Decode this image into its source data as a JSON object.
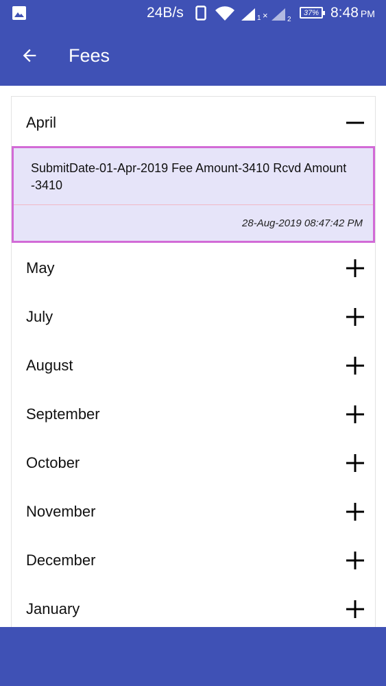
{
  "status_bar": {
    "net_speed": "24B/s",
    "battery": "37%",
    "time": "8:48",
    "ampm": "PM"
  },
  "app_bar": {
    "title": "Fees"
  },
  "expanded_month": {
    "label": "April",
    "entry": {
      "details": "SubmitDate-01-Apr-2019 Fee Amount-3410 Rcvd Amount -3410",
      "timestamp": "28-Aug-2019 08:47:42 PM"
    }
  },
  "collapsed_months": [
    {
      "label": "May"
    },
    {
      "label": "July"
    },
    {
      "label": "August"
    },
    {
      "label": "September"
    },
    {
      "label": "October"
    },
    {
      "label": "November"
    },
    {
      "label": "December"
    },
    {
      "label": "January"
    }
  ],
  "colors": {
    "primary": "#3f51b5",
    "entry_background": "#e6e4f9",
    "entry_border": "#d26ad6"
  }
}
